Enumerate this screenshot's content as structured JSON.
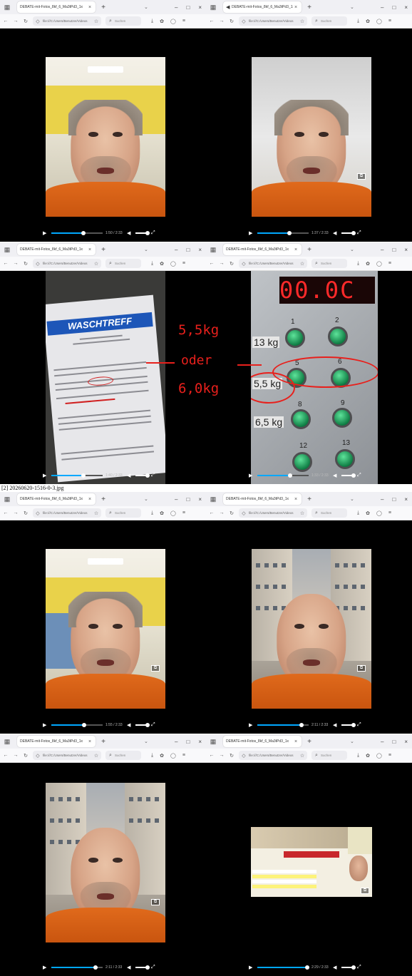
{
  "caption": "[2] 20260620-1516-0-3.jpg",
  "browser": {
    "tab_title": "DEBATE-mit-Fotos_8kf_6_Ma3tPd3_1x",
    "url": "file:///C:/Users/Benutzer/Videos",
    "search_placeholder": "Suchen",
    "icons": [
      "sidebar-icon",
      "speaker-icon",
      "close-icon",
      "new-tab-icon",
      "tab-list-icon",
      "minimize-icon",
      "maximize-icon",
      "window-close-icon",
      "back-icon",
      "forward-icon",
      "reload-icon",
      "shield-icon",
      "lock-icon",
      "bookmark-icon",
      "search-icon",
      "download-icon",
      "extensions-icon",
      "account-icon",
      "menu-icon"
    ]
  },
  "videos": [
    {
      "time": "1:50 / 2:33",
      "progress": 0.62
    },
    {
      "time": "1:37 / 2:33",
      "progress": 0.63
    },
    {
      "time": "1:40 / 2:33",
      "progress": 0.62
    },
    {
      "time": "1:33 / 2:33",
      "progress": 0.64
    },
    {
      "time": "1:55 / 2:33",
      "progress": 0.64
    },
    {
      "time": "2:11 / 2:33",
      "progress": 0.86
    },
    {
      "time": "2:11 / 2:33",
      "progress": 0.86
    },
    {
      "time": "2:29 / 2:33",
      "progress": 0.97
    }
  ],
  "receipt": {
    "brand": "WASCHTREFF"
  },
  "annotation": {
    "line1": "5,5kg",
    "line2": "oder",
    "line3": "6,0kg"
  },
  "panel": {
    "display": "00.0C",
    "buttons": [
      "1",
      "2",
      "5",
      "6",
      "8",
      "9",
      "12",
      "13"
    ],
    "labels": [
      "13 kg",
      "5,5 kg",
      "6,5 kg"
    ]
  },
  "colors": {
    "accent_progress": "#00a8ff",
    "annotation_red": "#e8201c",
    "shirt_orange": "#e06a1c"
  }
}
